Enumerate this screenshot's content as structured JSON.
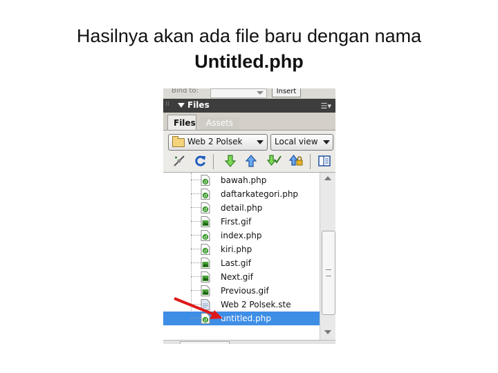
{
  "slide": {
    "title_line1": "Hasilnya akan ada file baru dengan nama",
    "title_line2": "Untitled.php"
  },
  "panel": {
    "bind_to_label": "Bind to:",
    "insert_label": "Insert",
    "panel_title": "Files",
    "tabs": [
      {
        "label": "Files",
        "active": true
      },
      {
        "label": "Assets",
        "active": false
      }
    ],
    "site_select": "Web 2 Polsek",
    "view_select": "Local view",
    "toolbar_icons": [
      "connect-icon",
      "refresh-icon",
      "get-files-icon",
      "put-files-icon",
      "check-out-icon",
      "check-in-icon",
      "expand-icon"
    ],
    "files": [
      {
        "name": "bawah.php",
        "icon": "php-file-icon",
        "selected": false
      },
      {
        "name": "daftarkategori.php",
        "icon": "php-file-icon",
        "selected": false
      },
      {
        "name": "detail.php",
        "icon": "php-file-icon",
        "selected": false
      },
      {
        "name": "First.gif",
        "icon": "gif-file-icon",
        "selected": false
      },
      {
        "name": "index.php",
        "icon": "php-file-icon",
        "selected": false
      },
      {
        "name": "kiri.php",
        "icon": "php-file-icon",
        "selected": false
      },
      {
        "name": "Last.gif",
        "icon": "gif-file-icon",
        "selected": false
      },
      {
        "name": "Next.gif",
        "icon": "gif-file-icon",
        "selected": false
      },
      {
        "name": "Previous.gif",
        "icon": "gif-file-icon",
        "selected": false
      },
      {
        "name": "Web 2 Polsek.ste",
        "icon": "ste-file-icon",
        "selected": false
      },
      {
        "name": "untitled.php",
        "icon": "php-file-icon",
        "selected": true
      }
    ]
  },
  "colors": {
    "selection": "#3e8ee6",
    "arrow": "#e01818",
    "panel_header": "#3d3d3d"
  }
}
